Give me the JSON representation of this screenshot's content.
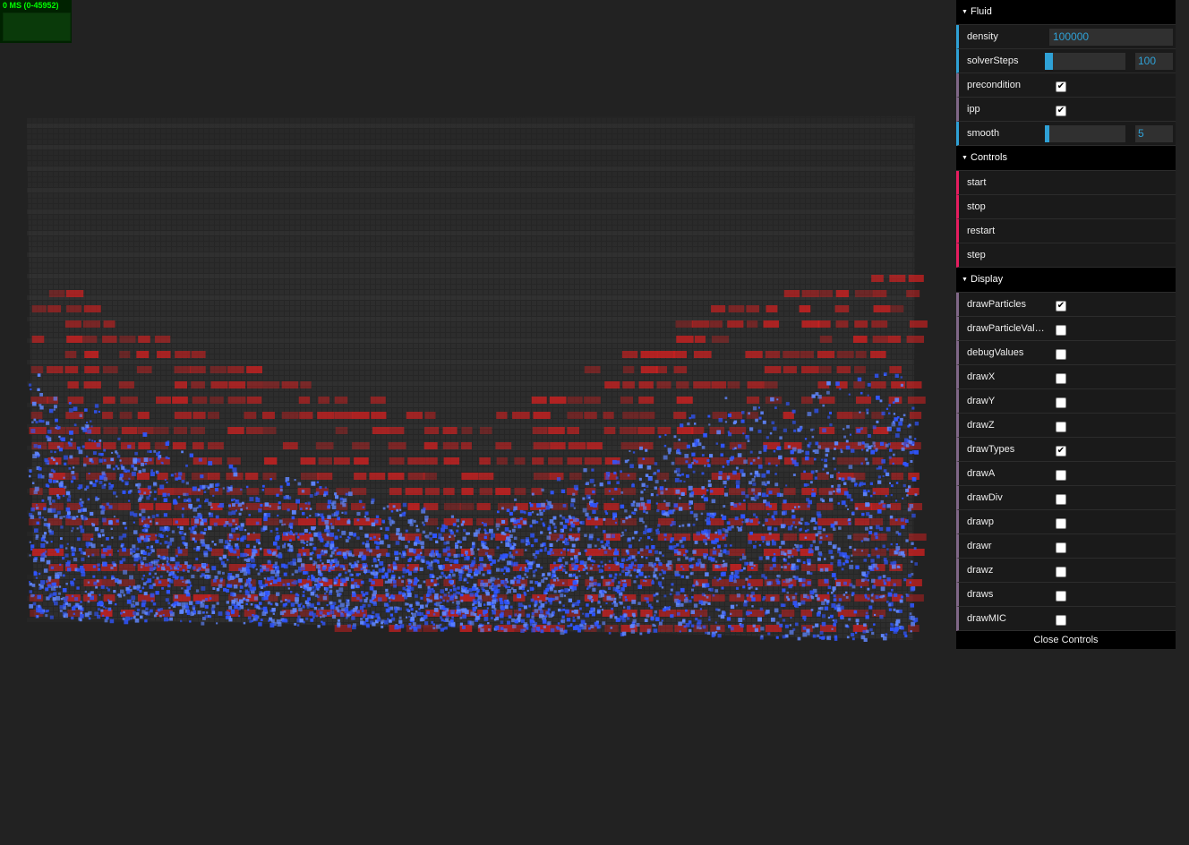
{
  "stats": {
    "text": "0 MS (0-45952)"
  },
  "gui": {
    "folders": [
      {
        "title": "Fluid",
        "rows": [
          {
            "label": "density",
            "type": "text",
            "value": "100000"
          },
          {
            "label": "solverSteps",
            "type": "slider",
            "value": "100",
            "fill": 0.1
          },
          {
            "label": "precondition",
            "type": "checkbox",
            "checked": true
          },
          {
            "label": "ipp",
            "type": "checkbox",
            "checked": true
          },
          {
            "label": "smooth",
            "type": "slider",
            "value": "5",
            "fill": 0.05
          }
        ]
      },
      {
        "title": "Controls",
        "rows": [
          {
            "label": "start",
            "type": "function"
          },
          {
            "label": "stop",
            "type": "function"
          },
          {
            "label": "restart",
            "type": "function"
          },
          {
            "label": "step",
            "type": "function"
          }
        ]
      },
      {
        "title": "Display",
        "rows": [
          {
            "label": "drawParticles",
            "type": "checkbox",
            "checked": true
          },
          {
            "label": "drawParticleValues",
            "type": "checkbox",
            "checked": false
          },
          {
            "label": "debugValues",
            "type": "checkbox",
            "checked": false
          },
          {
            "label": "drawX",
            "type": "checkbox",
            "checked": false
          },
          {
            "label": "drawY",
            "type": "checkbox",
            "checked": false
          },
          {
            "label": "drawZ",
            "type": "checkbox",
            "checked": false
          },
          {
            "label": "drawTypes",
            "type": "checkbox",
            "checked": true
          },
          {
            "label": "drawA",
            "type": "checkbox",
            "checked": false
          },
          {
            "label": "drawDiv",
            "type": "checkbox",
            "checked": false
          },
          {
            "label": "drawp",
            "type": "checkbox",
            "checked": false
          },
          {
            "label": "drawr",
            "type": "checkbox",
            "checked": false
          },
          {
            "label": "drawz",
            "type": "checkbox",
            "checked": false
          },
          {
            "label": "draws",
            "type": "checkbox",
            "checked": false
          },
          {
            "label": "drawMIC",
            "type": "checkbox",
            "checked": false
          }
        ]
      }
    ],
    "close_label": "Close Controls"
  },
  "colors": {
    "background": "#222222",
    "grid": "#333333",
    "particles": "#2f55ff",
    "types": "#d42020",
    "accent": "#2fa1d6"
  }
}
